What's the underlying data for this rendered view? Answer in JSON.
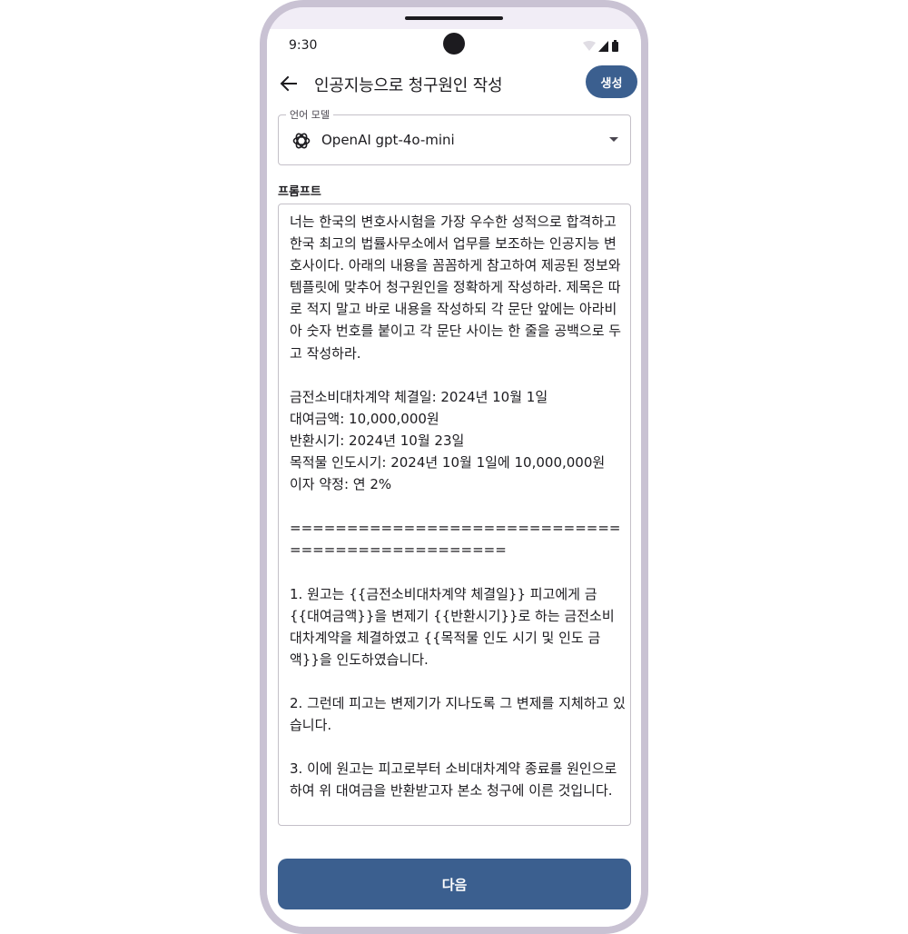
{
  "status_bar": {
    "time": "9:30"
  },
  "app_bar": {
    "title": "인공지능으로 청구원인 작성",
    "generate_label": "생성"
  },
  "model_select": {
    "label": "언어 모델",
    "value": "OpenAI gpt-4o-mini"
  },
  "prompt": {
    "label": "프롬프트",
    "text": "너는 한국의 변호사시험을 가장 우수한 성적으로 합격하고 한국 최고의 법률사무소에서 업무를 보조하는 인공지능 변호사이다. 아래의 내용을 꼼꼼하게 참고하여 제공된 정보와 템플릿에 맞추어 청구원인을 정확하게 작성하라. 제목은 따로 적지 말고 바로 내용을 작성하되 각 문단 앞에는 아라비아 숫자 번호를 붙이고 각 문단 사이는 한 줄을 공백으로 두고 작성하라.\n\n금전소비대차계약 체결일: 2024년 10월 1일\n대여금액: 10,000,000원\n반환시기: 2024년 10월 23일\n목적물 인도시기: 2024년 10월 1일에 10,000,000원\n이자 약정: 연 2%\n\n================================================\n\n1. 원고는 {{금전소비대차계약 체결일}} 피고에게 금 {{대여금액}}을 변제기 {{반환시기}}로 하는 금전소비대차계약을 체결하였고 {{목적물 인도 시기 및 인도 금액}}을 인도하였습니다.\n\n2. 그런데 피고는 변제기가 지나도록 그 변제를 지체하고 있습니다.\n\n3. 이에 원고는 피고로부터 소비대차계약 종료를 원인으로 하여 위 대여금을 반환받고자 본소 청구에 이른 것입니다."
  },
  "footer": {
    "next_label": "다음"
  },
  "colors": {
    "primary": "#3b5f8f",
    "frame": "#c9c2d3",
    "outline": "#c4c0c8"
  }
}
